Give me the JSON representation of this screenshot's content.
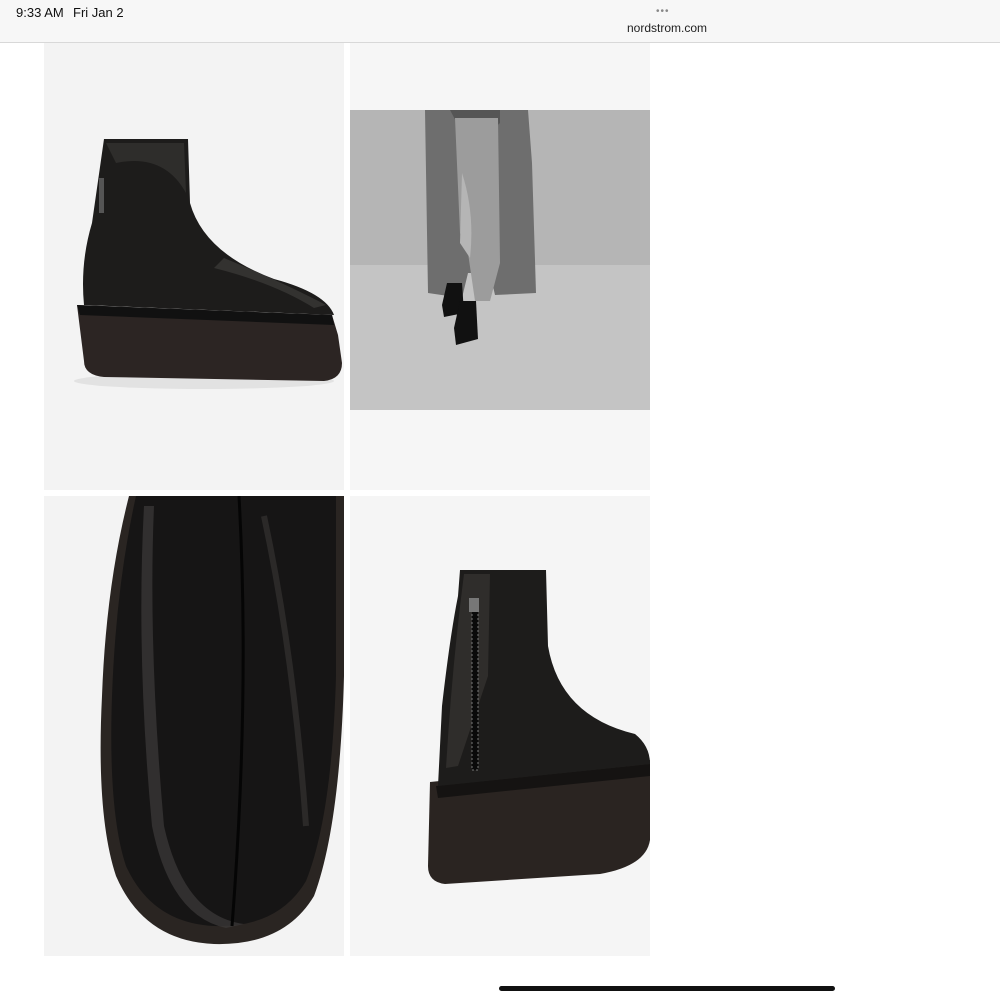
{
  "status": {
    "time": "9:33 AM",
    "date": "Fri Jan 2",
    "tab_dots": "•••"
  },
  "browser": {
    "url": "nordstrom.com"
  },
  "gallery": {
    "images": [
      {
        "name": "boot-side-view",
        "icon": "boot-image"
      },
      {
        "name": "model-wearing-boots",
        "icon": "model-image"
      },
      {
        "name": "boot-toe-closeup",
        "icon": "closeup-image"
      },
      {
        "name": "boot-back-zip-view",
        "icon": "boot-back-image"
      }
    ]
  }
}
